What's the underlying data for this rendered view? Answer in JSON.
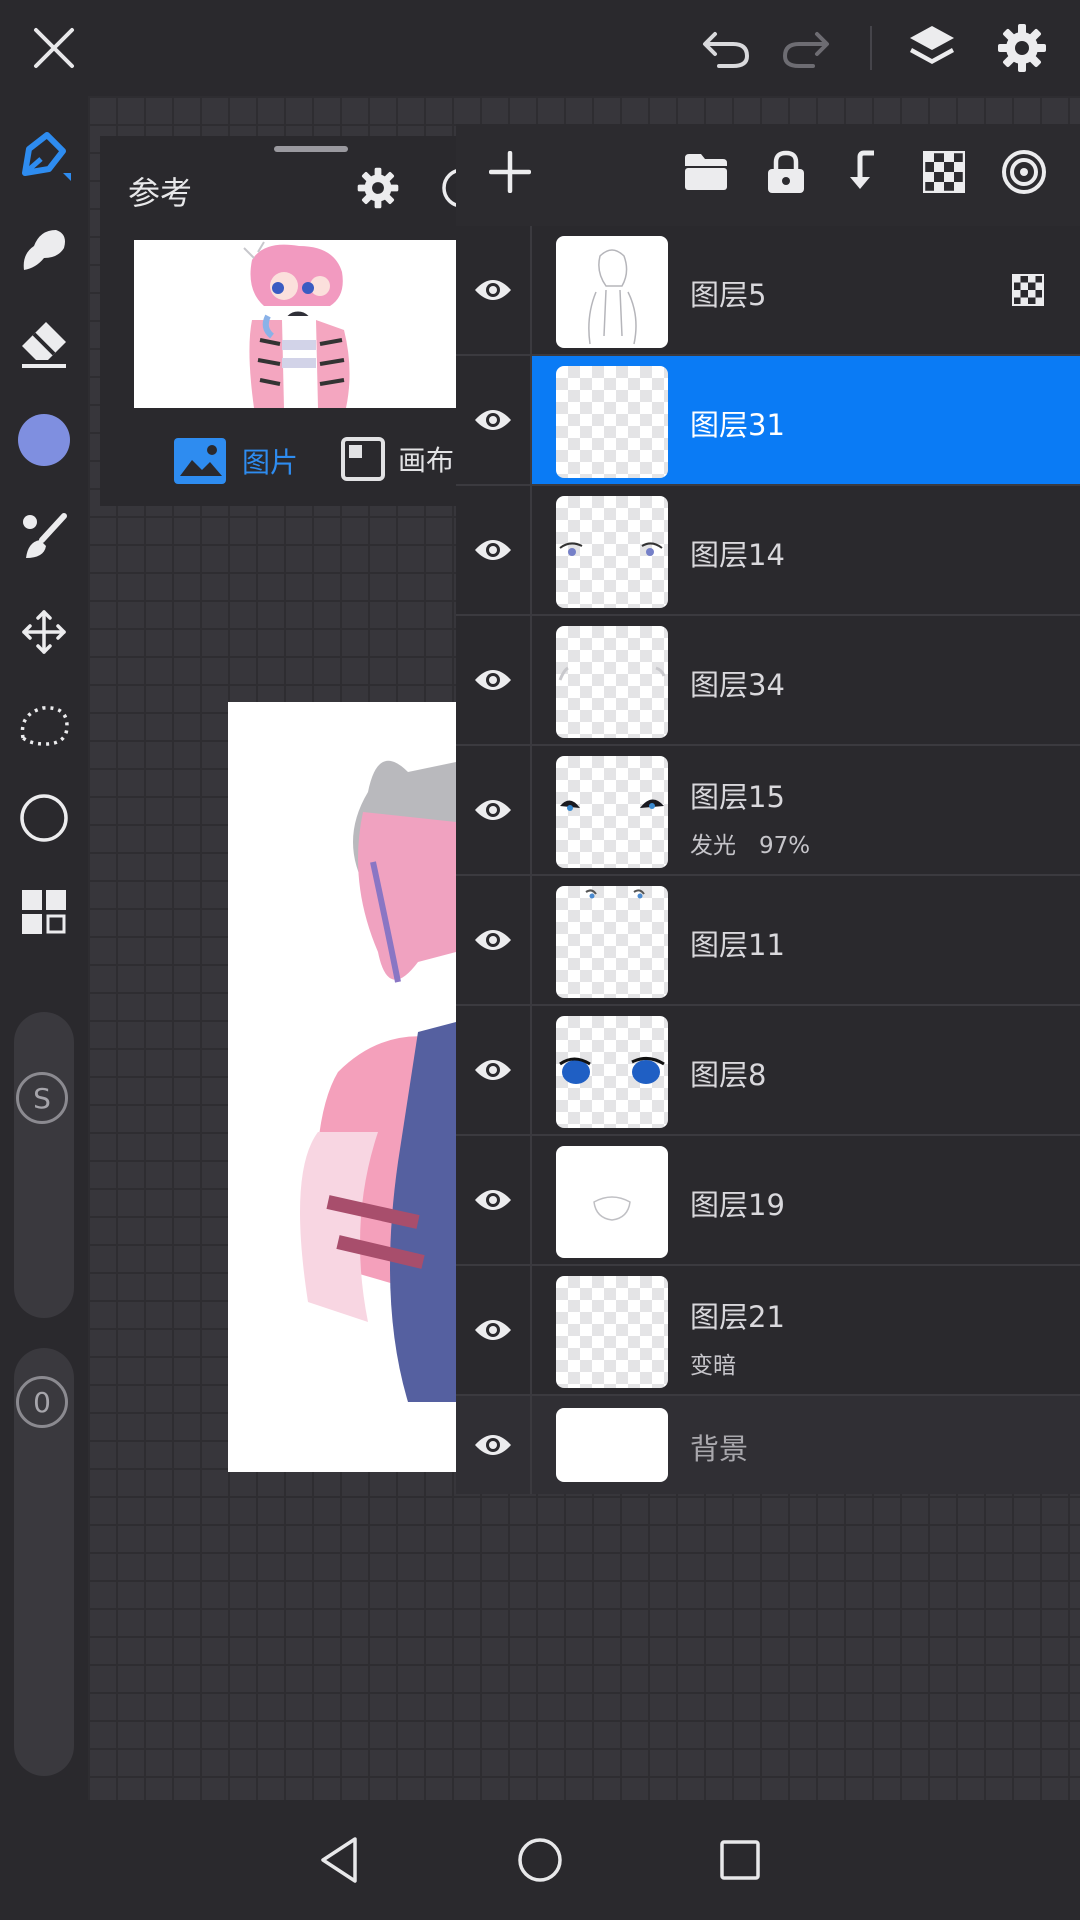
{
  "reference_panel": {
    "title": "参考",
    "tab_image": "图片",
    "tab_canvas": "画布"
  },
  "brush_size_value": "S",
  "opacity_value": "0",
  "layers": [
    {
      "name": "图层5",
      "sub": ""
    },
    {
      "name": "图层31",
      "sub": "",
      "selected": true
    },
    {
      "name": "图层14",
      "sub": ""
    },
    {
      "name": "图层34",
      "sub": ""
    },
    {
      "name": "图层15",
      "sub": "发光　97%"
    },
    {
      "name": "图层11",
      "sub": ""
    },
    {
      "name": "图层8",
      "sub": ""
    },
    {
      "name": "图层19",
      "sub": ""
    },
    {
      "name": "图层21",
      "sub": "变暗"
    },
    {
      "name": "背景",
      "sub": ""
    }
  ],
  "colors": {
    "accent": "#0a7bf5",
    "current_color": "#7f8fe0",
    "tab_active": "#2e8cf0"
  }
}
